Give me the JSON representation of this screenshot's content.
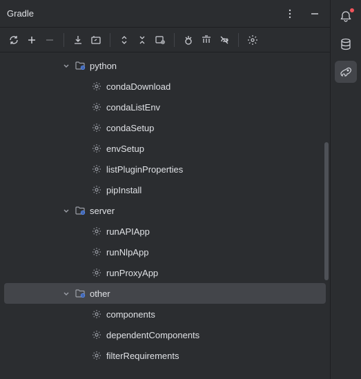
{
  "header": {
    "title": "Gradle"
  },
  "tree": {
    "nodes": [
      {
        "type": "folder",
        "label": "python",
        "indent": 88,
        "expanded": true
      },
      {
        "type": "task",
        "label": "condaDownload",
        "indent": 132
      },
      {
        "type": "task",
        "label": "condaListEnv",
        "indent": 132
      },
      {
        "type": "task",
        "label": "condaSetup",
        "indent": 132
      },
      {
        "type": "task",
        "label": "envSetup",
        "indent": 132
      },
      {
        "type": "task",
        "label": "listPluginProperties",
        "indent": 132
      },
      {
        "type": "task",
        "label": "pipInstall",
        "indent": 132
      },
      {
        "type": "folder",
        "label": "server",
        "indent": 88,
        "expanded": true
      },
      {
        "type": "task",
        "label": "runAPIApp",
        "indent": 132
      },
      {
        "type": "task",
        "label": "runNlpApp",
        "indent": 132
      },
      {
        "type": "task",
        "label": "runProxyApp",
        "indent": 132
      },
      {
        "type": "folder",
        "label": "other",
        "indent": 88,
        "expanded": true,
        "selected": true
      },
      {
        "type": "task",
        "label": "components",
        "indent": 132
      },
      {
        "type": "task",
        "label": "dependentComponents",
        "indent": 132
      },
      {
        "type": "task",
        "label": "filterRequirements",
        "indent": 132
      }
    ]
  }
}
